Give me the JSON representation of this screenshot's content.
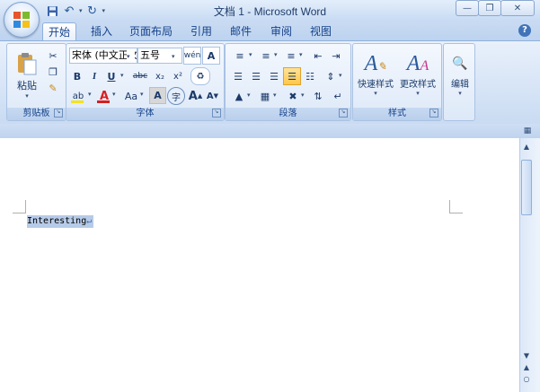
{
  "window": {
    "title": "文档 1 - Microsoft Word"
  },
  "quick_access": {
    "save_icon": "save-icon",
    "undo_icon": "undo-icon",
    "redo_icon": "redo-icon",
    "undo_glyph": "↶",
    "undo_dropdown_glyph": "▾",
    "redo_glyph": "↻",
    "customize_glyph": "▾"
  },
  "tabs": [
    {
      "label": "开始",
      "active": true
    },
    {
      "label": "插入"
    },
    {
      "label": "页面布局"
    },
    {
      "label": "引用"
    },
    {
      "label": "邮件"
    },
    {
      "label": "审阅"
    },
    {
      "label": "视图"
    }
  ],
  "ribbon": {
    "clipboard": {
      "label": "剪贴板",
      "paste_label": "粘贴",
      "paste_caret": "▾"
    },
    "font": {
      "label": "字体",
      "font_name": "宋体 (中文正文",
      "font_size": "五号",
      "grow_glyph": "A",
      "shrink_glyph": "A",
      "bold": "B",
      "italic": "I",
      "underline": "U",
      "strike": "abc",
      "subscript": "x₂",
      "superscript": "x²",
      "change_case": "Aa",
      "char_border": "A",
      "encircle": "字",
      "char_shade": "A",
      "char_scale": "A",
      "phonetic_glyph": "wén",
      "font_color": "A",
      "font_color_value": "#d81e1e",
      "highlight_color_value": "#f6e21e"
    },
    "paragraph": {
      "label": "段落"
    },
    "styles": {
      "label": "样式",
      "quick_styles": "快速样式",
      "change_styles": "更改样式"
    },
    "editing": {
      "label": "编辑"
    }
  },
  "document": {
    "text": "Interesting",
    "paragraph_mark": "↵"
  }
}
